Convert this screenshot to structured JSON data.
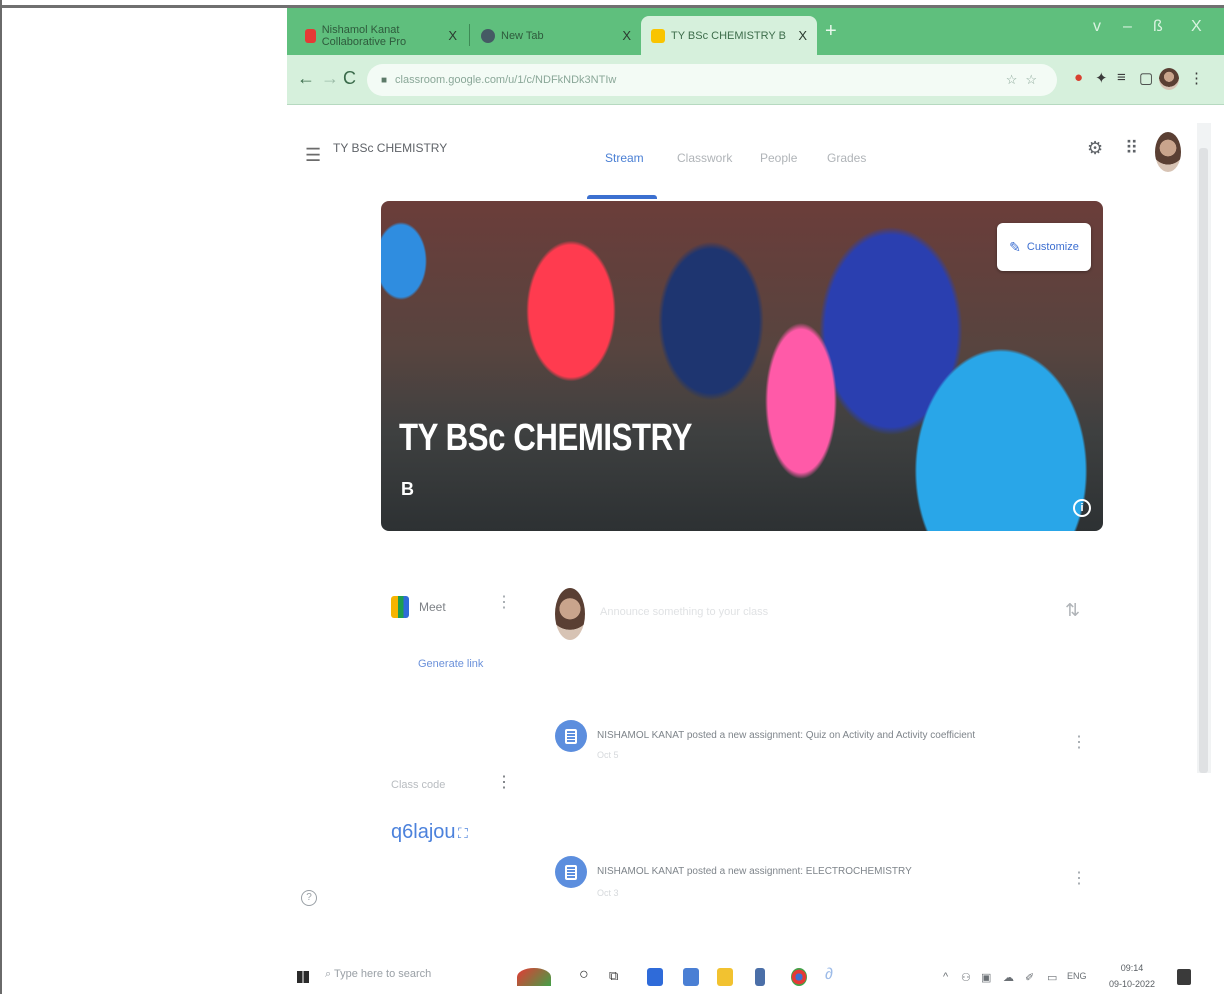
{
  "browser": {
    "tabs": [
      {
        "title": "Nishamol Kanat Collaborative Pro",
        "close": "X",
        "favicon_color": "#e53935"
      },
      {
        "title": "New Tab",
        "close": "X",
        "favicon_color": "#455a64"
      },
      {
        "title": "TY BSc CHEMISTRY B",
        "close": "X",
        "favicon_color": "#f9c400"
      }
    ],
    "new_tab_symbol": "+",
    "window_controls": [
      "v",
      "–",
      "ß",
      "X"
    ],
    "url": "classroom.google.com/u/1/c/NDFkNDk3NTIw",
    "back": "←",
    "forward": "→",
    "reload": "C"
  },
  "classroom": {
    "class_name": "TY BSc CHEMISTRY",
    "nav_tabs": [
      "Stream",
      "Classwork",
      "People",
      "Grades"
    ],
    "active_tab": "Stream",
    "banner": {
      "title": "TY BSc CHEMISTRY",
      "section": "B",
      "customize_label": "Customize"
    },
    "meet": {
      "label": "Meet",
      "generate_link": "Generate link"
    },
    "class_code": {
      "label": "Class code",
      "value": "q6lajou"
    },
    "announce_placeholder": "Announce something to your class",
    "posts": [
      {
        "text": "NISHAMOL KANAT posted a new assignment: Quiz on Activity and Activity coefficient",
        "date": "Oct 5"
      },
      {
        "text": "NISHAMOL KANAT posted a new assignment: ELECTROCHEMISTRY",
        "date": "Oct 3"
      }
    ]
  },
  "taskbar": {
    "search_placeholder": "Type here to search",
    "language": "ENG",
    "time": "09:14",
    "date": "09-10-2022"
  }
}
